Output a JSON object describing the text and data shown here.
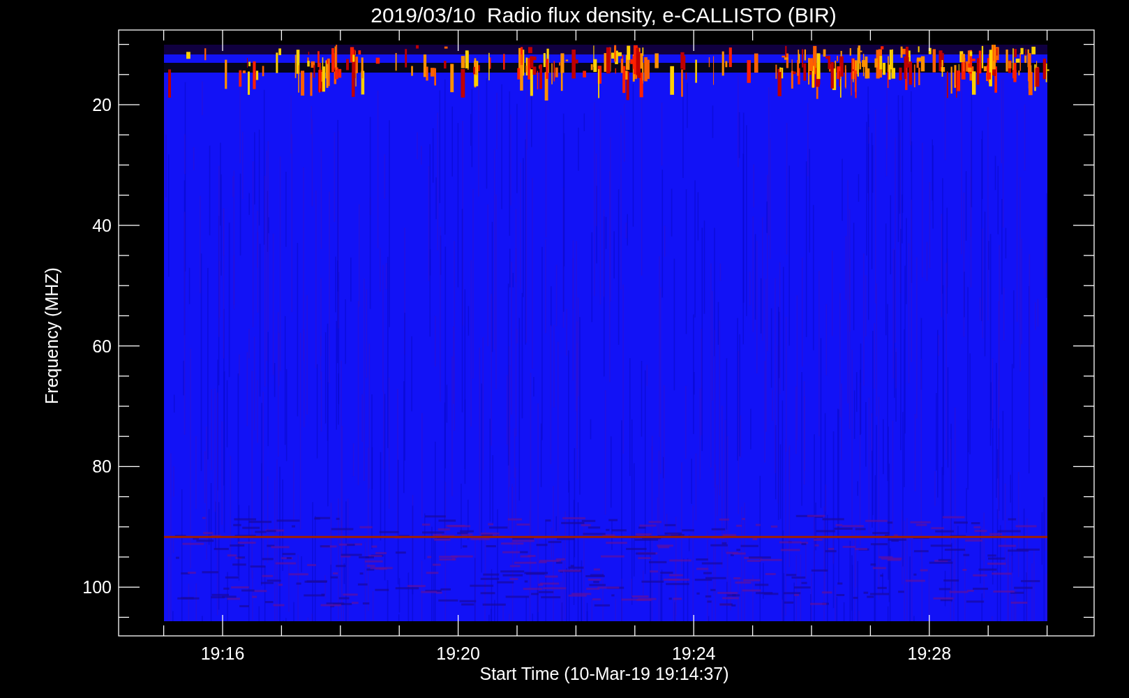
{
  "plot": {
    "title": "2019/03/10  Radio flux density, e-CALLISTO (BIR)",
    "y_axis": {
      "label": "Frequency (MHZ)",
      "ticks": [
        "20",
        "40",
        "60",
        "80",
        "100"
      ]
    },
    "x_axis": {
      "label": "Start Time (10-Mar-19 19:14:37)",
      "ticks": [
        "19:16",
        "19:20",
        "19:24",
        "19:28"
      ]
    }
  }
}
